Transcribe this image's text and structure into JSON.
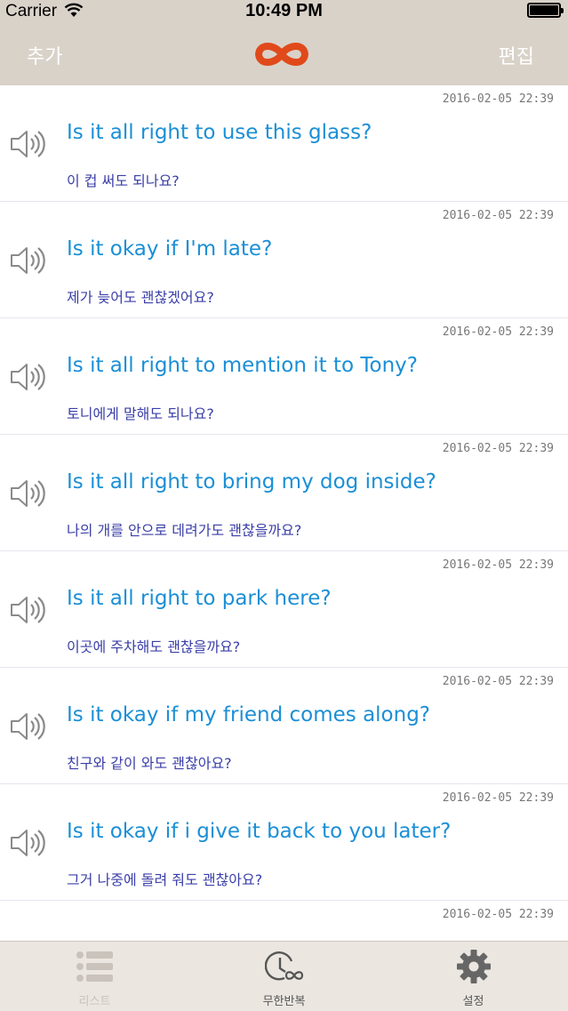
{
  "status_bar": {
    "carrier": "Carrier",
    "time": "10:49 PM"
  },
  "nav": {
    "add_label": "추가",
    "edit_label": "편집",
    "logo_icon": "infinity-icon",
    "logo_color": "#e04a1b"
  },
  "items": [
    {
      "timestamp": "2016-02-05 22:39",
      "english": "Is it all right to use this glass?",
      "korean": "이 컵 써도 되나요?"
    },
    {
      "timestamp": "2016-02-05 22:39",
      "english": "Is it okay if I'm late?",
      "korean": "제가 늦어도 괜찮겠어요?"
    },
    {
      "timestamp": "2016-02-05 22:39",
      "english": "Is it all right to mention it to Tony?",
      "korean": "토니에게 말해도 되나요?"
    },
    {
      "timestamp": "2016-02-05 22:39",
      "english": "Is it all right to bring my dog inside?",
      "korean": "나의 개를 안으로 데려가도 괜찮을까요?"
    },
    {
      "timestamp": "2016-02-05 22:39",
      "english": "Is it all right to park here?",
      "korean": "이곳에 주차해도 괜찮을까요?"
    },
    {
      "timestamp": "2016-02-05 22:39",
      "english": "Is it okay if my friend comes along?",
      "korean": "친구와 같이 와도 괜찮아요?"
    },
    {
      "timestamp": "2016-02-05 22:39",
      "english": "Is it okay if i give it back to you later?",
      "korean": "그거 나중에 돌려 줘도 괜찮아요?"
    },
    {
      "timestamp": "2016-02-05 22:39",
      "english": "",
      "korean": ""
    }
  ],
  "tabs": [
    {
      "label": "리스트",
      "icon": "list-icon",
      "color": "#c9c3bb"
    },
    {
      "label": "무한반복",
      "icon": "repeat-clock-icon",
      "color": "#555555"
    },
    {
      "label": "설정",
      "icon": "gear-icon",
      "color": "#555555"
    }
  ]
}
